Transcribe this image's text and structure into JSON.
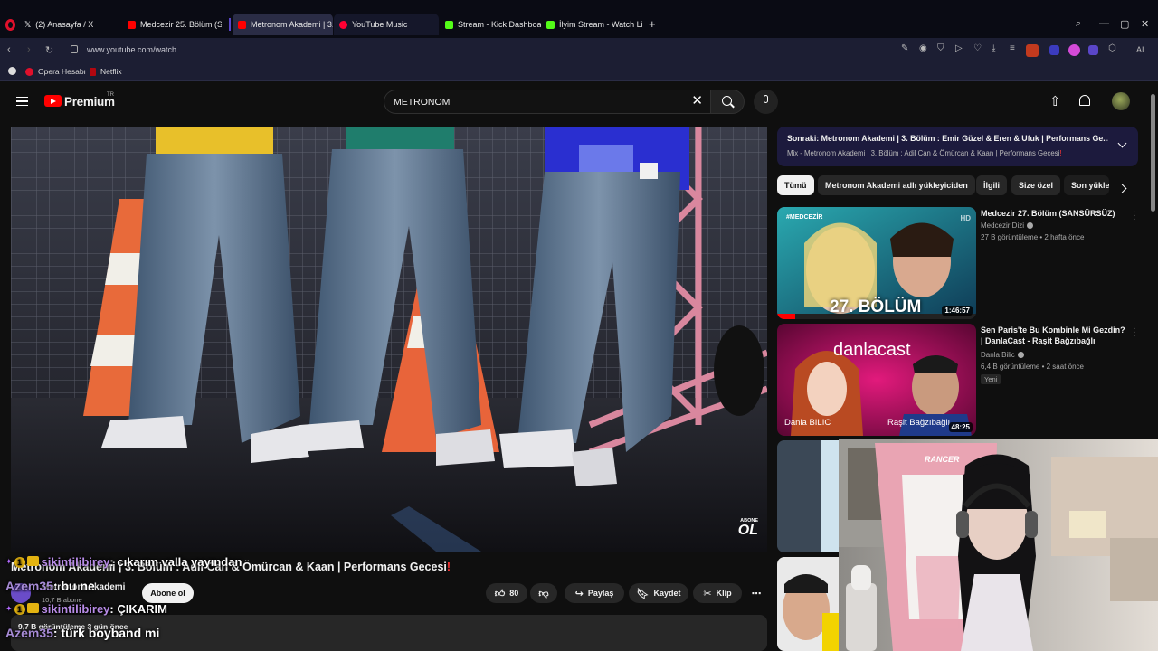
{
  "browser": {
    "tabs": [
      {
        "label": "(2) Anasayfa / X",
        "icon": "x-icon"
      },
      {
        "label": "Medcezir 25. Bölüm (SANSÜ",
        "icon": "youtube-icon"
      },
      {
        "label": "Metronom Akademi | 3. B",
        "icon": "youtube-icon",
        "active": true
      },
      {
        "label": "YouTube Music",
        "icon": "youtube-music-icon"
      },
      {
        "label": "Stream - Kick Dashboard",
        "icon": "kick-icon"
      },
      {
        "label": "İlyim Stream - Watch Live",
        "icon": "kick-icon"
      }
    ],
    "url": "www.youtube.com/watch",
    "bookmarks": [
      {
        "label": "Opera Hesabı"
      },
      {
        "label": "Netflix"
      }
    ],
    "ai_label": "AI"
  },
  "youtube": {
    "brand": "Premium",
    "country": "TR",
    "search_value": "METRONOM"
  },
  "video": {
    "title": "Metronom Akademi | 3. Bölüm : Adil Can & Ömürcan & Kaan | Performans Gecesi",
    "title_mark": "!",
    "watermark_top": "ABONE",
    "watermark_bottom": "OL",
    "channel": "Metronom Akademi",
    "subscribers": "10,7 B abone",
    "subscribe_label": "Abone ol",
    "likes": "80",
    "share_label": "Paylaş",
    "save_label": "Kaydet",
    "clip_label": "Klip",
    "views_meta": "9,7 B görüntüleme  3 gün önce"
  },
  "chat": [
    {
      "user": "sikintilibirey",
      "message": ": cıkarım valla yayından",
      "badges": true
    },
    {
      "user": "Azem35",
      "message": ": bu ne",
      "badges": false
    },
    {
      "user": "sikintilibirey",
      "message": ": ÇIKARIM",
      "badges": true
    },
    {
      "user": "Azem35",
      "message": ": türk boyband mi",
      "badges": false
    }
  ],
  "sidebar": {
    "up_next_label": "Sonraki:",
    "up_next_title": "Metronom Akademi | 3. Bölüm : Emir Güzel & Eren & Ufuk | Performans Ge...",
    "up_next_sub": "Mix - Metronom Akademi | 3. Bölüm : Adil Can & Ömürcan & Kaan | Performans Gecesi",
    "up_next_mark": "!",
    "chips": [
      "Tümü",
      "Metronom Akademi adlı yükleyiciden",
      "İlgili",
      "Size özel",
      "Son yükle"
    ],
    "videos": [
      {
        "title": "Medcezir 27. Bölüm (SANSÜRSÜZ)",
        "channel": "Medcezir Dizi",
        "meta": "27 B görüntüleme • 2 hafta önce",
        "duration": "1:46:57",
        "thumb_text": "27. BÖLÜM",
        "thumb_tag": "#MEDCEZİR",
        "thumb_hd": "HD"
      },
      {
        "title": "Sen Paris'te Bu Kombinle Mi Gezdin? | DanlaCast - Raşit Bağzıbağlı",
        "channel": "Danla Bilic",
        "meta": "6,4 B görüntüleme • 2 saat önce",
        "badge": "Yeni",
        "duration": "48:25",
        "thumb_logo": "danlacast",
        "thumb_left_name": "Danla BILIC",
        "thumb_right_name": "Raşit Bağzıbağlı"
      }
    ]
  },
  "webcam": {
    "chair_brand": "RANCER"
  }
}
